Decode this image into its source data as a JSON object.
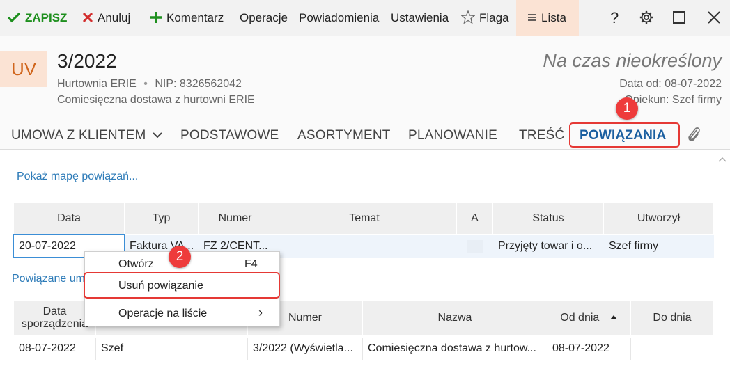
{
  "toolbar": {
    "save": "ZAPISZ",
    "cancel": "Anuluj",
    "comment": "Komentarz",
    "operations": "Operacje",
    "notifications": "Powiadomienia",
    "settings": "Ustawienia",
    "flag": "Flaga",
    "list": "Lista",
    "help": "?"
  },
  "header": {
    "logo": "UV",
    "title": "3/2022",
    "company": "Hurtownia ERIE",
    "separator": "•",
    "nip": "NIP: 8326562042",
    "description": "Comiesięczna dostawa z hurtowni ERIE",
    "period": "Na czas nieokreślony",
    "date_from": "Data od: 08-07-2022",
    "guardian": "Opiekun: Szef firmy"
  },
  "tabs": [
    "UMOWA Z KLIENTEM",
    "PODSTAWOWE",
    "ASORTYMENT",
    "PLANOWANIE",
    "TREŚĆ",
    "POWIĄZANIA"
  ],
  "badges": [
    "1",
    "2"
  ],
  "content": {
    "map_link": "Pokaż mapę powiązań...",
    "related_link": "Powiązane um"
  },
  "table1": {
    "headers": [
      "Data",
      "Typ",
      "Numer",
      "Temat",
      "A",
      "Status",
      "Utworzył"
    ],
    "row": [
      "20-07-2022",
      "Faktura VA...",
      "FZ 2/CENT...",
      "",
      "",
      "Przyjęty towar i o...",
      "Szef firmy"
    ]
  },
  "context_menu": {
    "open": "Otwórz",
    "open_shortcut": "F4",
    "remove": "Usuń powiązanie",
    "list_ops": "Operacje na liście",
    "submenu_arrow": "›"
  },
  "table2": {
    "headers": [
      "Data sporządzenia",
      "Numer",
      "Nazwa",
      "Od dnia",
      "Do dnia"
    ],
    "row": [
      "08-07-2022",
      "Szef",
      "3/2022 (Wyświetla...",
      "Comiesięczna dostawa z hurtow...",
      "08-07-2022",
      ""
    ]
  },
  "colors": {
    "accent": "#1b5fa0",
    "save_green": "#1e8f1e",
    "cancel_red": "#d32f2f",
    "highlight": "#e53935",
    "logo_bg": "#fbe3d4",
    "logo_text": "#d0651c"
  },
  "icons": [
    "check-icon",
    "x-icon",
    "plus-icon",
    "star-icon",
    "menu-icon",
    "help-icon",
    "gear-icon",
    "maximize-icon",
    "close-icon",
    "chevron-down-icon",
    "paperclip-icon",
    "sort-asc-icon"
  ]
}
